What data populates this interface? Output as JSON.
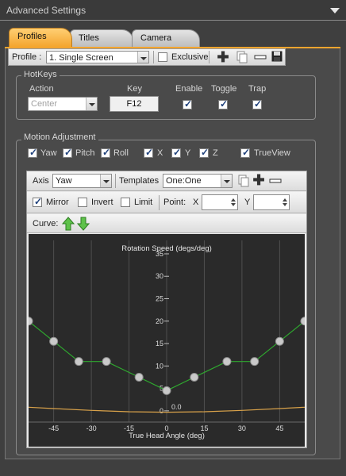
{
  "header": {
    "title": "Advanced Settings"
  },
  "tabs": [
    {
      "label": "Profiles",
      "active": true
    },
    {
      "label": "Titles",
      "active": false
    },
    {
      "label": "Camera",
      "active": false
    }
  ],
  "profile_bar": {
    "label": "Profile :",
    "selected": "1. Single Screen",
    "exclusive_label": "Exclusive",
    "exclusive_checked": false,
    "icons": [
      "add-icon",
      "copy-icon",
      "remove-icon",
      "save-icon"
    ]
  },
  "hotkeys": {
    "title": "HotKeys",
    "col_action": "Action",
    "col_key": "Key",
    "col_enable": "Enable",
    "col_toggle": "Toggle",
    "col_trap": "Trap",
    "action_value": "Center",
    "key_value": "F12",
    "enable": true,
    "toggle": true,
    "trap": true
  },
  "motion": {
    "title": "Motion Adjustment",
    "axes": [
      {
        "label": "Yaw",
        "checked": true
      },
      {
        "label": "Pitch",
        "checked": true
      },
      {
        "label": "Roll",
        "checked": true
      },
      {
        "label": "X",
        "checked": true
      },
      {
        "label": "Y",
        "checked": true
      },
      {
        "label": "Z",
        "checked": true
      },
      {
        "label": "TrueView",
        "checked": true
      }
    ]
  },
  "curve_toolbar": {
    "axis_label": "Axis",
    "axis_value": "Yaw",
    "templates_label": "Templates",
    "templates_value": "One:One",
    "mirror_label": "Mirror",
    "mirror_checked": true,
    "invert_label": "Invert",
    "invert_checked": false,
    "limit_label": "Limit",
    "limit_checked": false,
    "point_label": "Point:",
    "x_label": "X",
    "y_label": "Y",
    "x_value": "",
    "y_value": "",
    "curve_label": "Curve:"
  },
  "colors": {
    "accent": "#f4a52e",
    "curve": "#2fa82f",
    "secondary": "#d9a24a",
    "chart_bg": "#2a2a2a"
  },
  "chart_data": {
    "type": "line",
    "xlabel": "True Head Angle (deg)",
    "ylabel": "Rotation Speed (degs/deg)",
    "xlim": [
      -55,
      55
    ],
    "ylim": [
      -2.5,
      38
    ],
    "x_ticks": [
      -45,
      -30,
      -15,
      0,
      15,
      30,
      45
    ],
    "y_ticks": [
      0,
      5,
      10,
      15,
      20,
      25,
      30,
      35
    ],
    "annotation": "0.0",
    "series": [
      {
        "points": [
          [
            -55,
            20
          ],
          [
            -45,
            15.5
          ],
          [
            -35,
            11
          ],
          [
            -24,
            11
          ],
          [
            -11,
            7.5
          ],
          [
            0,
            4.5
          ],
          [
            11,
            7.5
          ],
          [
            24,
            11
          ],
          [
            35,
            11
          ],
          [
            45,
            15.5
          ],
          [
            55,
            20
          ]
        ]
      },
      {
        "points": [
          [
            -55,
            0.8
          ],
          [
            -45,
            0.5
          ],
          [
            -30,
            0.1
          ],
          [
            -15,
            -0.2
          ],
          [
            0,
            -0.3
          ],
          [
            15,
            -0.2
          ],
          [
            30,
            0.1
          ],
          [
            45,
            0.5
          ],
          [
            55,
            0.8
          ]
        ]
      }
    ]
  }
}
